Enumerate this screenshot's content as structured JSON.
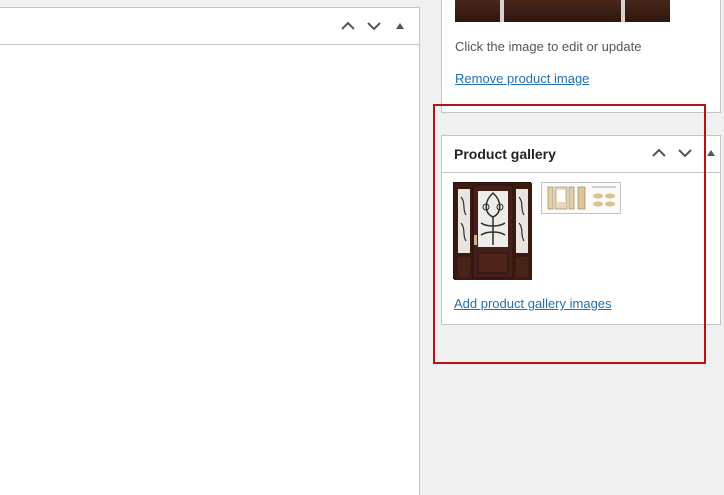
{
  "main_panel": {
    "controls": [
      {
        "name": "move-up",
        "icon": "chevron-up-icon"
      },
      {
        "name": "move-down",
        "icon": "chevron-down-icon"
      },
      {
        "name": "toggle-panel",
        "icon": "triangle-up-icon"
      }
    ]
  },
  "product_image": {
    "help_text": "Click the image to edit or update",
    "remove_link": "Remove product image"
  },
  "product_gallery": {
    "title": "Product gallery",
    "images": [
      {
        "name": "gallery-image-door"
      },
      {
        "name": "gallery-image-door-options"
      }
    ],
    "add_link": "Add product gallery images"
  },
  "colors": {
    "link": "#2271b1",
    "border": "#c3c4c7",
    "background": "#f0f0f1",
    "highlight": "#b31217",
    "door_wood": "#3b1a12"
  }
}
